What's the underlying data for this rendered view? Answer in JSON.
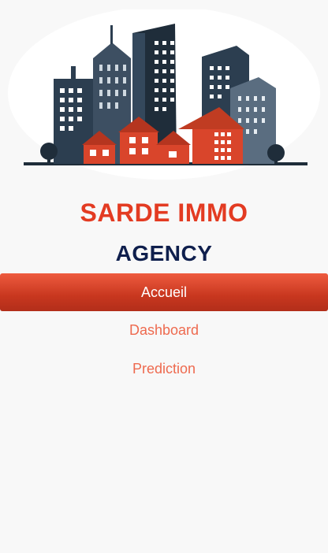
{
  "brand": {
    "name": "SARDE IMMO",
    "subtitle": "AGENCY",
    "name_color": "#e33b22",
    "subtitle_color": "#0f1f4d"
  },
  "logo": {
    "icon": "city-buildings-logo",
    "dark_color": "#2c3e50",
    "accent_color": "#d9452b"
  },
  "nav": {
    "items": [
      {
        "label": "Accueil",
        "active": true
      },
      {
        "label": "Dashboard",
        "active": false
      },
      {
        "label": "Prediction",
        "active": false
      }
    ],
    "active_bg": "#d9452b",
    "active_text": "#ffffff",
    "inactive_text": "#ee6a4f"
  }
}
